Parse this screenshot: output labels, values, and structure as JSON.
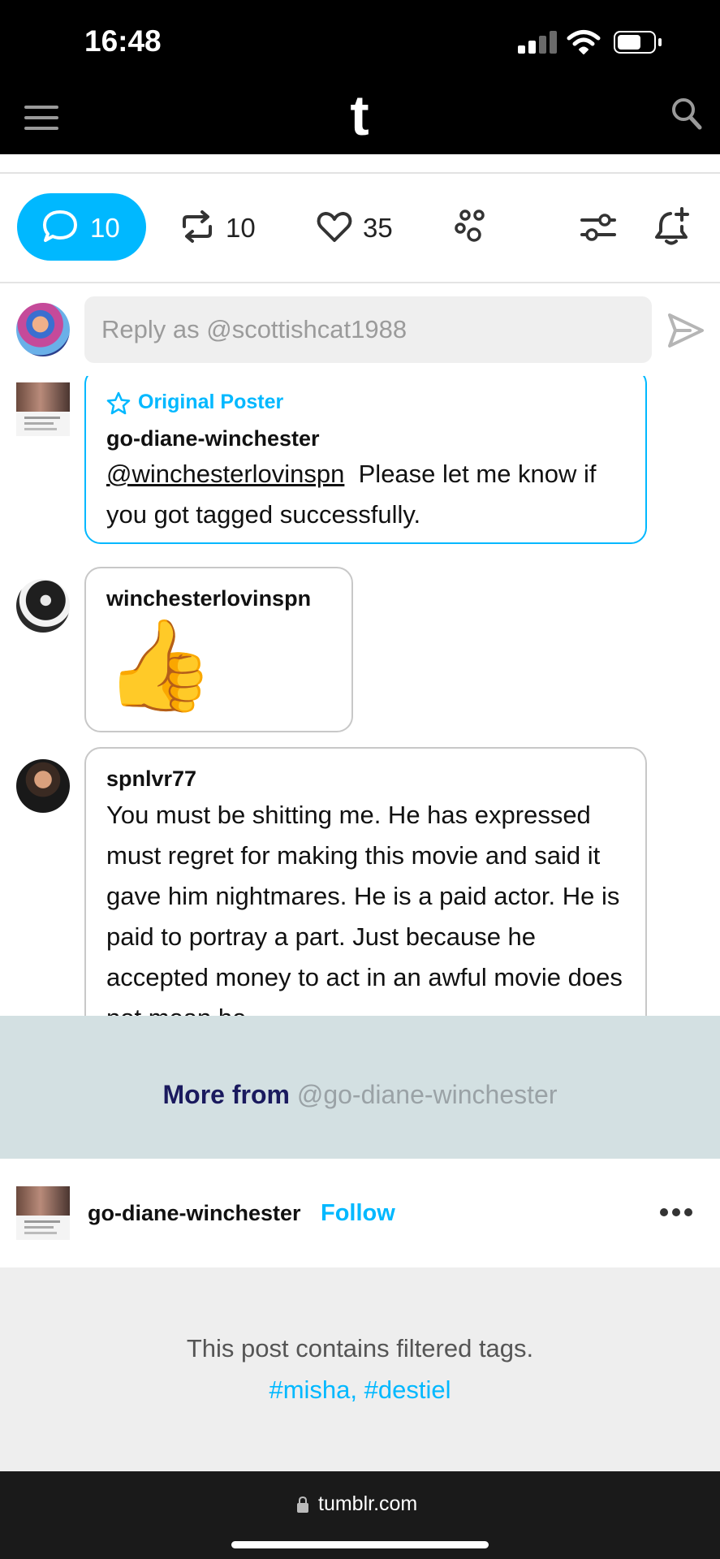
{
  "status_bar": {
    "time": "16:48"
  },
  "header": {
    "logo": "t"
  },
  "actions": {
    "replies_count": "10",
    "reblogs_count": "10",
    "likes_count": "35"
  },
  "reply": {
    "placeholder": "Reply as @scottishcat1988"
  },
  "comments": [
    {
      "badge": "Original Poster",
      "username": "go-diane-winchester",
      "mention": "@winchesterlovinspn",
      "text": "Please let me know if you got tagged successfully."
    },
    {
      "username": "winchesterlovinspn",
      "emoji": "👍"
    },
    {
      "username": "spnlvr77",
      "text": "You must be shitting me. He has expressed must regret for making this movie and said it gave him nightmares. He is a paid actor. He is paid to portray a part. Just because he accepted money to act in an awful movie does not mean he"
    }
  ],
  "more_from": {
    "label": "More from",
    "handle": "@go-diane-winchester"
  },
  "post": {
    "username": "go-diane-winchester",
    "follow_label": "Follow"
  },
  "filtered": {
    "message": "This post contains filtered tags.",
    "tags": "#misha, #destiel"
  },
  "browser": {
    "url": "tumblr.com"
  },
  "colors": {
    "accent": "#00b8ff",
    "more_band": "#d3e0e2",
    "more_label": "#1a1a5e"
  }
}
